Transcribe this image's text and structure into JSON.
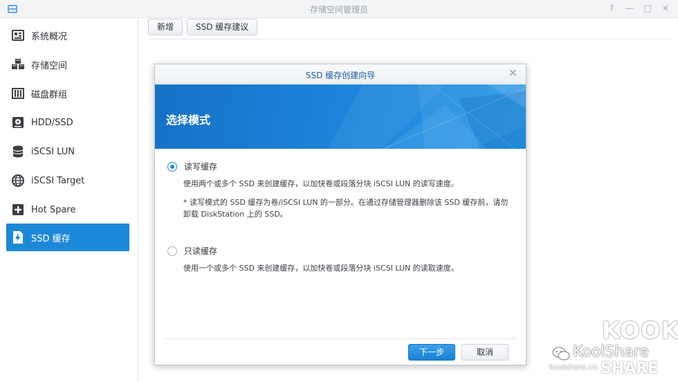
{
  "window": {
    "title": "存储空间管理员",
    "controls": [
      "?",
      "—",
      "□",
      "✕"
    ]
  },
  "sidebar": {
    "items": [
      {
        "label": "系统概况",
        "icon": "overview-icon",
        "active": false
      },
      {
        "label": "存储空间",
        "icon": "storage-cubes-icon",
        "active": false
      },
      {
        "label": "磁盘群组",
        "icon": "disk-group-icon",
        "active": false
      },
      {
        "label": "HDD/SSD",
        "icon": "hard-drive-icon",
        "active": false
      },
      {
        "label": "iSCSI LUN",
        "icon": "database-icon",
        "active": false
      },
      {
        "label": "iSCSI Target",
        "icon": "globe-icon",
        "active": false
      },
      {
        "label": "Hot Spare",
        "icon": "plus-box-icon",
        "active": false
      },
      {
        "label": "SSD 缓存",
        "icon": "ssd-cache-icon",
        "active": true
      }
    ]
  },
  "toolbar": {
    "add_label": "新增",
    "advice_label": "SSD 缓存建议"
  },
  "modal": {
    "title": "SSD 缓存创建向导",
    "close_label": "✕",
    "banner_title": "选择模式",
    "options": [
      {
        "label": "读写缓存",
        "checked": true,
        "description": "使用两个或多个 SSD 来创建缓存，以加快卷或段落分块 iSCSI LUN 的读写速度。",
        "note": "* 读写模式的 SSD 缓存为卷/iSCSI LUN 的一部分。在通过存储管理器删除该 SSD 缓存前，请勿卸载 DiskStation 上的 SSD。"
      },
      {
        "label": "只读缓存",
        "checked": false,
        "description": "使用一个或多个 SSD 来创建缓存，以加快卷或段落分块 iSCSI LUN 的读取速度。"
      }
    ],
    "next_label": "下一步",
    "cancel_label": "取消"
  },
  "watermark": {
    "big": "KOOK",
    "mid": "KoolShare",
    "small": "koolshare.cn",
    "share": "SHARE"
  },
  "colors": {
    "accent": "#1e88d8",
    "banner": "#1b82d8",
    "title_blue": "#1f5fa8"
  }
}
